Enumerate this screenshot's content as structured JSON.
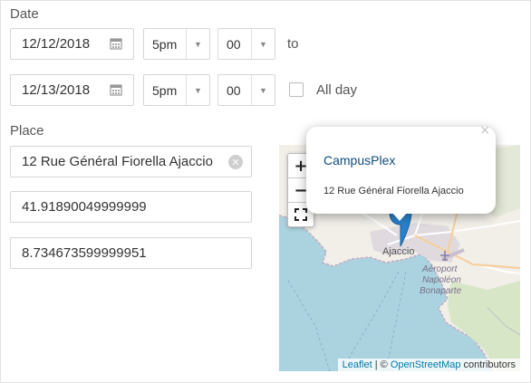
{
  "date": {
    "label": "Date",
    "start": {
      "date": "12/12/2018",
      "hour": "5pm",
      "minute": "00"
    },
    "to_label": "to",
    "end": {
      "date": "12/13/2018",
      "hour": "5pm",
      "minute": "00"
    },
    "all_day_label": "All day",
    "all_day_checked": false
  },
  "place": {
    "label": "Place",
    "address": "12 Rue Général Fiorella Ajaccio",
    "latitude": "41.91890049999999",
    "longitude": "8.734673599999951"
  },
  "map": {
    "zoom_in": "+",
    "zoom_out": "−",
    "popup": {
      "title": "CampusPlex",
      "address": "12 Rue Général Fiorella Ajaccio",
      "close": "×"
    },
    "labels": {
      "city": "Ajaccio",
      "airport_1": "Aéroport",
      "airport_2": "Napoléon",
      "airport_3": "Bonaparte"
    },
    "attribution": {
      "leaflet": "Leaflet",
      "separator": " | © ",
      "osm": "OpenStreetMap",
      "suffix": " contributors"
    },
    "colors": {
      "water": "#aad3df",
      "land": "#f2efe9",
      "marker": "#2a81cb"
    }
  },
  "icons": {
    "calendar": "calendar-icon",
    "clear": "clear-circle-icon",
    "fullscreen": "fullscreen-icon",
    "marker": "map-marker-icon",
    "airport": "airplane-icon"
  }
}
